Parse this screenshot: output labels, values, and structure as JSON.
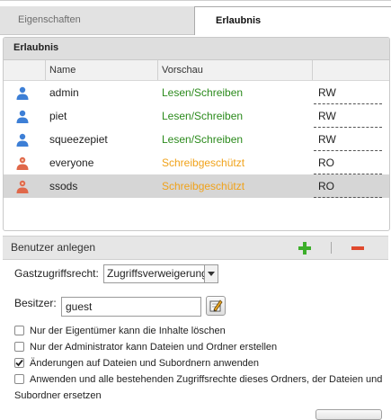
{
  "tabs": [
    {
      "label": "Eigenschaften",
      "active": false
    },
    {
      "label": "Erlaubnis",
      "active": true
    }
  ],
  "permissions": {
    "title": "Erlaubnis",
    "columns": [
      "",
      "Name",
      "Vorschau",
      ""
    ],
    "rows": [
      {
        "name": "admin",
        "preview": "Lesen/Schreiben",
        "right": "RW",
        "icon": "user-icon",
        "selected": false
      },
      {
        "name": "piet",
        "preview": "Lesen/Schreiben",
        "right": "RW",
        "icon": "user-icon",
        "selected": false
      },
      {
        "name": "squeezepiet",
        "preview": "Lesen/Schreiben",
        "right": "RW",
        "icon": "user-icon",
        "selected": false
      },
      {
        "name": "everyone",
        "preview": "Schreibgeschützt",
        "right": "RO",
        "icon": "guest-user-icon",
        "selected": false
      },
      {
        "name": "ssods",
        "preview": "Schreibgeschützt",
        "right": "RO",
        "icon": "guest-user-icon",
        "selected": true
      }
    ]
  },
  "toolbar": {
    "label": "Benutzer anlegen",
    "add_icon": "plus-icon",
    "remove_icon": "minus-icon"
  },
  "form": {
    "guest_access_label": "Gastzugriffsrecht:",
    "guest_access_value": "Zugriffsverweigerung",
    "owner_label": "Besitzer:",
    "owner_value": "guest",
    "edit_icon": "edit-icon"
  },
  "checkboxes": [
    {
      "label": "Nur der Eigentümer kann die Inhalte löschen",
      "checked": false
    },
    {
      "label": "Nur der Administrator kann Dateien und Ordner erstellen",
      "checked": false
    },
    {
      "label": "Änderungen auf Dateien und Subordnern anwenden",
      "checked": true
    },
    {
      "label": "Anwenden und alle bestehenden Zugriffsrechte dieses Ordners, der Dateien und Subordner ersetzen",
      "checked": false
    }
  ],
  "colors": {
    "green_text": "#2b8a1c",
    "orange_text": "#f0a21a",
    "user_icon": "#3d7fd6",
    "guest_icon": "#e0684a"
  }
}
